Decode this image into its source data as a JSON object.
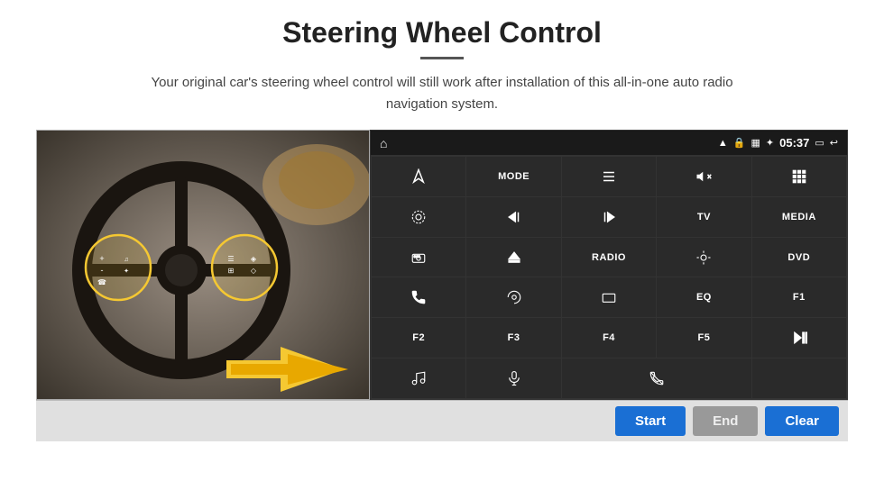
{
  "page": {
    "title": "Steering Wheel Control",
    "subtitle": "Your original car's steering wheel control will still work after installation of this all-in-one auto radio navigation system."
  },
  "status_bar": {
    "time": "05:37"
  },
  "grid_buttons": [
    {
      "id": "b1",
      "type": "icon",
      "icon": "navigate",
      "text": ""
    },
    {
      "id": "b2",
      "type": "text",
      "text": "MODE"
    },
    {
      "id": "b3",
      "type": "icon",
      "icon": "list",
      "text": ""
    },
    {
      "id": "b4",
      "type": "icon",
      "icon": "mute",
      "text": ""
    },
    {
      "id": "b5",
      "type": "icon",
      "icon": "apps",
      "text": ""
    },
    {
      "id": "b6",
      "type": "icon",
      "icon": "settings",
      "text": ""
    },
    {
      "id": "b7",
      "type": "icon",
      "icon": "prev",
      "text": ""
    },
    {
      "id": "b8",
      "type": "icon",
      "icon": "next",
      "text": ""
    },
    {
      "id": "b9",
      "type": "text",
      "text": "TV"
    },
    {
      "id": "b10",
      "type": "text",
      "text": "MEDIA"
    },
    {
      "id": "b11",
      "type": "icon",
      "icon": "360cam",
      "text": ""
    },
    {
      "id": "b12",
      "type": "icon",
      "icon": "eject",
      "text": ""
    },
    {
      "id": "b13",
      "type": "text",
      "text": "RADIO"
    },
    {
      "id": "b14",
      "type": "icon",
      "icon": "brightness",
      "text": ""
    },
    {
      "id": "b15",
      "type": "text",
      "text": "DVD"
    },
    {
      "id": "b16",
      "type": "icon",
      "icon": "phone",
      "text": ""
    },
    {
      "id": "b17",
      "type": "icon",
      "icon": "swirl",
      "text": ""
    },
    {
      "id": "b18",
      "type": "icon",
      "icon": "screen",
      "text": ""
    },
    {
      "id": "b19",
      "type": "text",
      "text": "EQ"
    },
    {
      "id": "b20",
      "type": "text",
      "text": "F1"
    },
    {
      "id": "b21",
      "type": "text",
      "text": "F2"
    },
    {
      "id": "b22",
      "type": "text",
      "text": "F3"
    },
    {
      "id": "b23",
      "type": "text",
      "text": "F4"
    },
    {
      "id": "b24",
      "type": "text",
      "text": "F5"
    },
    {
      "id": "b25",
      "type": "icon",
      "icon": "playpause",
      "text": ""
    },
    {
      "id": "b26",
      "type": "icon",
      "icon": "music",
      "text": ""
    },
    {
      "id": "b27",
      "type": "icon",
      "icon": "mic",
      "text": ""
    },
    {
      "id": "b28",
      "type": "icon",
      "icon": "hangup",
      "text": ""
    },
    {
      "id": "b29",
      "type": "empty",
      "text": ""
    },
    {
      "id": "b30",
      "type": "empty",
      "text": ""
    }
  ],
  "bottom_buttons": {
    "start_label": "Start",
    "end_label": "End",
    "clear_label": "Clear"
  }
}
